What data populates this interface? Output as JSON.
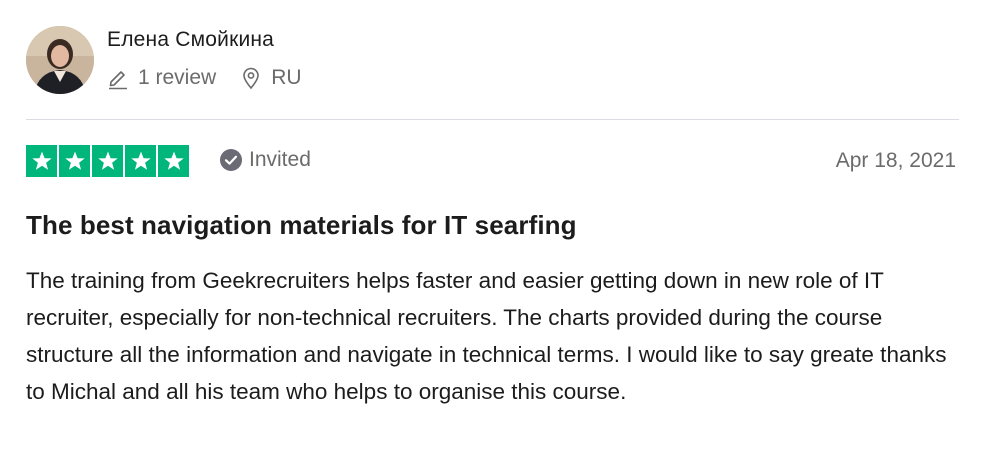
{
  "reviewer": {
    "name": "Елена Смойкина",
    "review_count": "1 review",
    "location": "RU",
    "avatar_icon": "avatar-photo",
    "review_icon": "pencil-icon",
    "location_icon": "location-pin-icon"
  },
  "review": {
    "rating": 5,
    "max_rating": 5,
    "rating_color": "#00b67a",
    "status_label": "Invited",
    "status_icon": "check-circle-icon",
    "date": "Apr 18, 2021",
    "title": "The best navigation materials for IT searfing",
    "body": "The training from Geekrecruiters helps faster and easier getting down in new role of IT recruiter, especially for non-technical recruiters. The charts provided during the course structure all the information and navigate in technical terms. I would like to say greate thanks to Michal and all his team who helps to organise this course."
  }
}
